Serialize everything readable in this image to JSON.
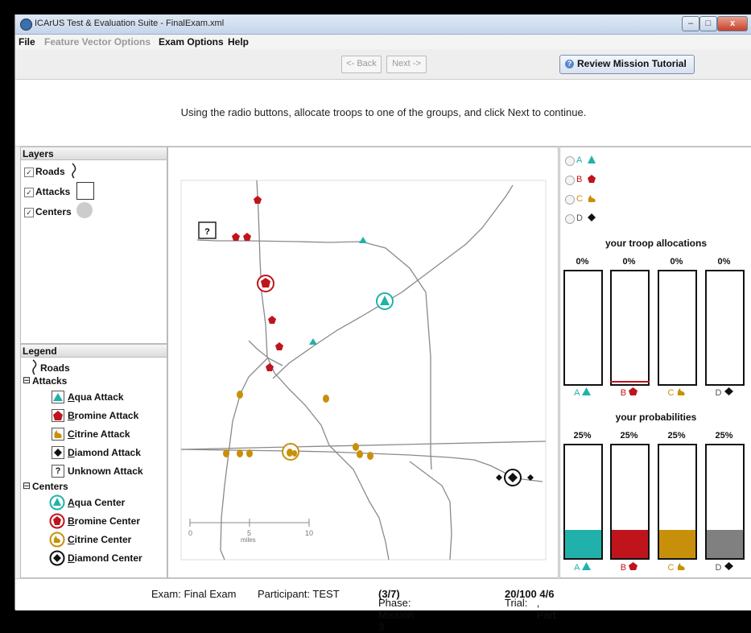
{
  "window": {
    "title": "ICArUS Test & Evaluation Suite - FinalExam.xml",
    "min": "–",
    "max": "□",
    "close": "x"
  },
  "menu": [
    "File",
    "Feature Vector Options",
    "Exam Options",
    "Help"
  ],
  "nav": {
    "back": "<- Back",
    "next": "Next ->",
    "tutorial": "Review Mission Tutorial"
  },
  "instruction": "Using the radio buttons, allocate troops to one of the groups, and click Next to continue.",
  "layers": {
    "title": "Layers",
    "items": [
      "Roads",
      "Attacks",
      "Centers"
    ],
    "check": "✓"
  },
  "legend": {
    "title": "Legend",
    "roads": "Roads",
    "attacks_title": "Attacks",
    "attacks": [
      {
        "key": "A",
        "rest": "qua Attack"
      },
      {
        "key": "B",
        "rest": "romine Attack"
      },
      {
        "key": "C",
        "rest": "itrine Attack"
      },
      {
        "key": "D",
        "rest": "iamond Attack"
      },
      {
        "key": "",
        "rest": "Unknown Attack"
      }
    ],
    "centers_title": "Centers",
    "centers": [
      {
        "key": "A",
        "rest": "qua Center"
      },
      {
        "key": "B",
        "rest": "romine Center"
      },
      {
        "key": "C",
        "rest": "itrine Center"
      },
      {
        "key": "D",
        "rest": "iamond Center"
      }
    ],
    "expander": "⊟"
  },
  "map": {
    "unknown_symbol": "?",
    "scale_ticks": [
      "0",
      "5",
      "10"
    ],
    "scale_unit": "miles"
  },
  "groups": [
    {
      "letter": "A",
      "color": "#20b2aa"
    },
    {
      "letter": "B",
      "color": "#c0141c"
    },
    {
      "letter": "C",
      "color": "#c8900a"
    },
    {
      "letter": "D",
      "color": "#222222"
    }
  ],
  "allocations": {
    "title": "your troop allocations",
    "values": [
      "0%",
      "0%",
      "0%",
      "0%"
    ],
    "levels": [
      0,
      0,
      0,
      0
    ]
  },
  "probabilities": {
    "title": "your probabilities",
    "values": [
      "25%",
      "25%",
      "25%",
      "25%"
    ],
    "levels": [
      0.25,
      0.25,
      0.25,
      0.25
    ],
    "colors": [
      "#20b2aa",
      "#c0141c",
      "#c8900a",
      "#808080"
    ]
  },
  "status": {
    "exam": "Exam: Final Exam",
    "participant": "Participant: TEST",
    "phase_label": "Phase: Mission 3",
    "phase_value": "(3/7)",
    "trial_label": "Trial:",
    "trial_value": "20/100",
    "part_label": ", Part:",
    "part_value": "4/6"
  }
}
